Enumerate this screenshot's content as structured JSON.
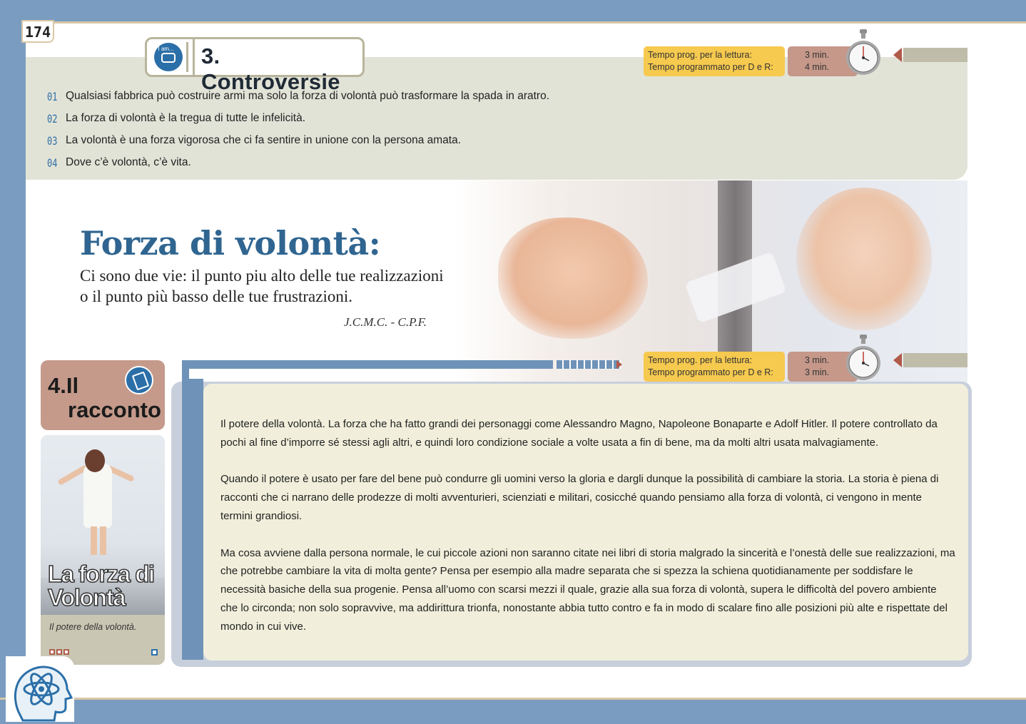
{
  "page_number": "174",
  "controversie": {
    "title": "3. Controversie",
    "icon": "i-am-icon",
    "icon_text": "I am...",
    "items": [
      {
        "num": "01",
        "text": "Qualsiasi fabbrica può costruire armi ma solo la forza di volontà può trasformare la spada in aratro."
      },
      {
        "num": "02",
        "text": "La forza di volontà è la tregua di tutte le infelicità."
      },
      {
        "num": "03",
        "text": "La volontà è una forza vigorosa che ci fa sentire in unione con la persona amata."
      },
      {
        "num": "04",
        "text": "Dove c’è volontà, c’è vita."
      }
    ],
    "timer": {
      "label_reading": "Tempo prog. per la lettura:",
      "label_dr": "Tempo programmato per D e R:",
      "value_reading": "3 min.",
      "value_dr": "4 min."
    }
  },
  "hero": {
    "title": "Forza di volontà:",
    "subtitle_line1": "Ci sono due vie: il punto piu alto delle tue realizzazioni",
    "subtitle_line2": "o il punto più basso delle tue frustrazioni.",
    "author": "J.C.M.C. - C.P.F."
  },
  "racconto": {
    "label_line1": "4.Il",
    "label_line2": "racconto",
    "image_title_line1": "La forza di",
    "image_title_line2": "Volontà",
    "caption": "Il potere della volontà.",
    "timer": {
      "label_reading": "Tempo prog. per la lettura:",
      "label_dr": "Tempo programmato per D e R:",
      "value_reading": "3 min.",
      "value_dr": "3 min."
    },
    "paragraphs": [
      "Il potere della volontà. La forza che ha fatto grandi dei personaggi come Alessandro Magno, Napoleone Bonaparte e Adolf Hitler. Il potere controllato da pochi al fine d’imporre sé stessi agli altri, e quindi loro condizione sociale a volte usata a fin di bene, ma da molti altri usata malvagiamente.",
      "Quando il potere è usato per fare del bene può condurre gli uomini verso la gloria e dargli dunque la possibilità di cambiare la storia. La storia è piena di racconti che ci narrano delle prodezze di molti avventurieri, scienziati e militari, cosicché quando pensiamo alla forza di volontà, ci vengono in mente termini grandiosi.",
      "Ma cosa avviene dalla persona normale, le cui piccole azioni non saranno citate nei libri di storia malgrado la sincerità e l’onestà delle sue realizzazioni, ma che potrebbe cambiare la vita di molta gente? Pensa per esempio alla madre separata che si spezza la schiena quotidianamente per soddisfare le  necessità basiche della sua progenie. Pensa all’uomo con scarsi mezzi il quale, grazie alla sua forza di volontà, supera le difficoltà del povero ambiente che lo circonda; non solo sopravvive, ma addirittura trionfa, nonostante abbia tutto contro e fa in modo di scalare fino alle posizioni più alte e rispettate del mondo in cui vive."
    ]
  },
  "colors": {
    "accent_blue": "#2f6590",
    "panel_beige": "#e2e3d7",
    "timer_yellow": "#f6c94f",
    "timer_rose": "#c5988a",
    "story_bg": "#f1efdb"
  }
}
